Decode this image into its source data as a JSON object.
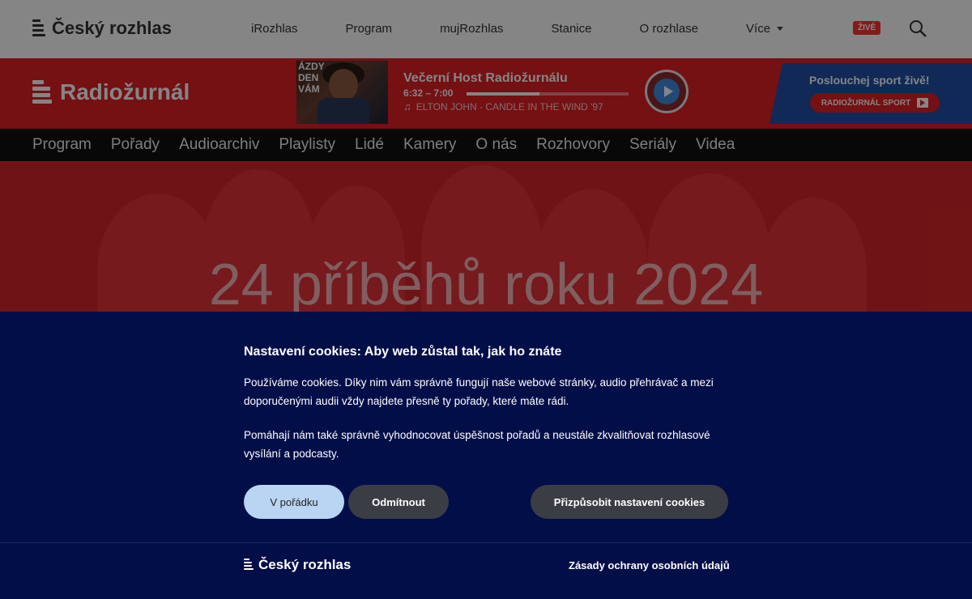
{
  "header": {
    "brand": "Český rozhlas",
    "nav": [
      "iRozhlas",
      "Program",
      "mujRozhlas",
      "Stanice",
      "O rozhlase",
      "Více"
    ],
    "live_badge": "ŽIVĚ"
  },
  "station": {
    "name": "Radiožurnál",
    "thumb_text": "ÁZDY\nDEN\nVÁM",
    "show_title": "Večerní Host Radiožurnálu",
    "show_time": "6:32 – 7:00",
    "progress": 0.45,
    "now_playing": "ELTON JOHN - CANDLE IN THE WIND '97",
    "sport_heading": "Poslouchej sport živě!",
    "sport_button": "RADIOŽURNÁL SPORT"
  },
  "main_nav": [
    "Program",
    "Pořady",
    "Audioarchiv",
    "Playlisty",
    "Lidé",
    "Kamery",
    "O nás",
    "Rozhovory",
    "Seriály",
    "Videa"
  ],
  "hero": {
    "title": "24 příběhů roku 2024"
  },
  "cookie_banner": {
    "title": "Nastavení cookies: Aby web zůstal tak, jak ho znáte",
    "paragraph1": "Používáme cookies. Díky nim vám správně fungují naše webové stránky, audio přehrávač a mezi doporučenými audii vždy najdete přesně ty pořady, které máte rádi.",
    "paragraph2": "Pomáhají nám také správně vyhodnocovat úspěšnost pořadů a neustále zkvalitňovat rozhlasové vysílání a podcasty.",
    "accept_label": "V pořádku",
    "reject_label": "Odmítnout",
    "customize_label": "Přizpůsobit nastavení cookies",
    "footer_brand": "Český rozhlas",
    "privacy_link": "Zásady ochrany osobních údajů"
  },
  "colors": {
    "station_red": "#e01f26",
    "sport_blue": "#1f4fa8",
    "cookie_navy": "#020e48",
    "accept_button": "#b9d5f3",
    "play_blue": "#3e8ce0"
  }
}
